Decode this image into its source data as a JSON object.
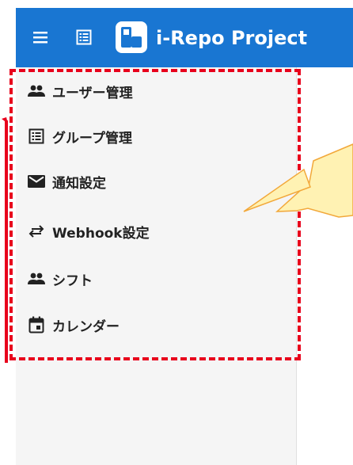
{
  "header": {
    "title": "i-Repo Project",
    "menu_icon": "hamburger-menu-icon",
    "list_icon": "list-view-icon",
    "logo_icon": "app-logo-icon"
  },
  "sidebar": {
    "items": [
      {
        "label": "ユーザー管理",
        "icon": "people-icon"
      },
      {
        "label": "グループ管理",
        "icon": "list-box-icon"
      },
      {
        "label": "通知設定",
        "icon": "mail-icon"
      },
      {
        "label": "Webhook設定",
        "icon": "swap-arrows-icon"
      },
      {
        "label": "シフト",
        "icon": "people-icon"
      },
      {
        "label": "カレンダー",
        "icon": "calendar-icon"
      }
    ]
  },
  "colors": {
    "header_bg": "#1976d2",
    "annotation_red": "#e8001c",
    "callout_fill": "#fff2b3"
  }
}
